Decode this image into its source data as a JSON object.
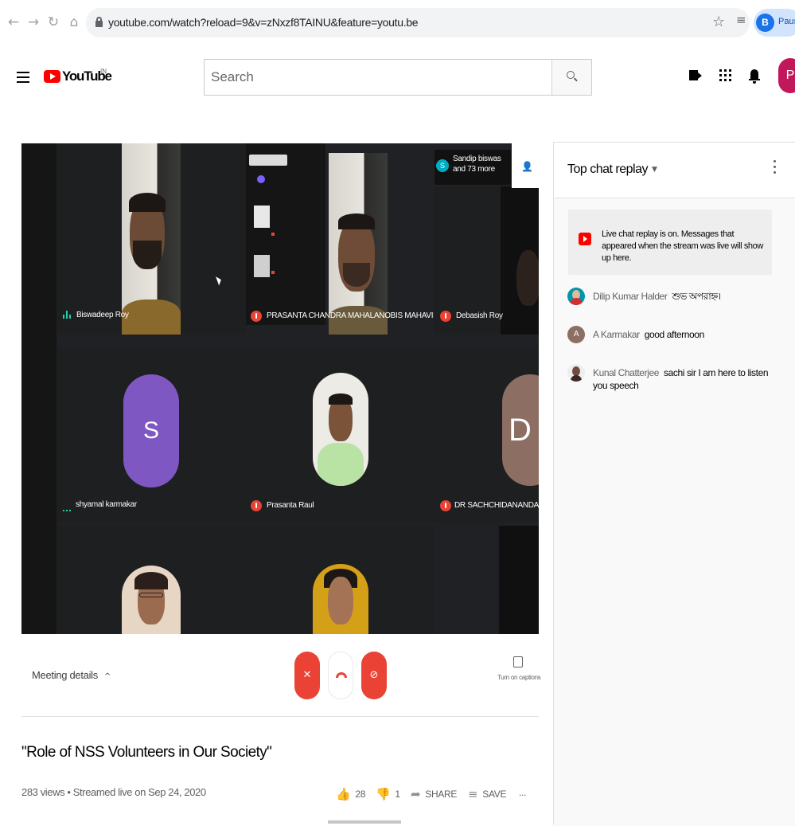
{
  "browser": {
    "url": "youtube.com/watch?reload=9&v=zNxzf8TAINU&feature=youtu.be",
    "profile_initial": "B",
    "profile_status": "Paused"
  },
  "masthead": {
    "logo_text": "YouTube",
    "logo_country": "IN",
    "search_placeholder": "Search",
    "avatar_initial": "P"
  },
  "meeting": {
    "participants": [
      {
        "name": "Biswadeep Roy"
      },
      {
        "name": "PRASANTA CHANDRA MAHALANOBIS MAHAVIDYALAYA"
      },
      {
        "name": "Debasish Roy"
      },
      {
        "name": "shyamal karmakar",
        "initial": "S"
      },
      {
        "name": "Prasanta Raul"
      },
      {
        "name": "DR SACHCHIDANANDA ROY",
        "initial": "D"
      }
    ],
    "others_badge_initial": "S",
    "others_badge_line1": "Sandip biswas",
    "others_badge_line2": "and 73 more",
    "meeting_details_label": "Meeting details",
    "captions_label": "Turn on captions"
  },
  "video": {
    "title": "\"Role of NSS Volunteers in Our Society\"",
    "meta": "283 views • Streamed live on Sep 24, 2020",
    "likes": "28",
    "dislikes": "1",
    "share_label": "SHARE",
    "save_label": "SAVE",
    "more_label": "..."
  },
  "chat": {
    "header": "Top chat replay",
    "banner": "Live chat replay is on. Messages that appeared when the stream was live will show up here.",
    "messages": [
      {
        "author": "Dilip Kumar Halder",
        "text": "শুভ অপরাহ্ন।",
        "avatar_color": "#0097a7",
        "avatar_initial": ""
      },
      {
        "author": "A Karmakar",
        "text": "good afternoon",
        "avatar_color": "#8d6e63",
        "avatar_initial": "A"
      },
      {
        "author": "Kunal Chatterjee",
        "text": "sachi sir I am here to listen you speech",
        "avatar_color": "#5d4037",
        "avatar_initial": ""
      }
    ]
  },
  "colors": {
    "brand_red": "#ff0000",
    "meet_red": "#ea4335",
    "meet_bg": "#202124"
  }
}
